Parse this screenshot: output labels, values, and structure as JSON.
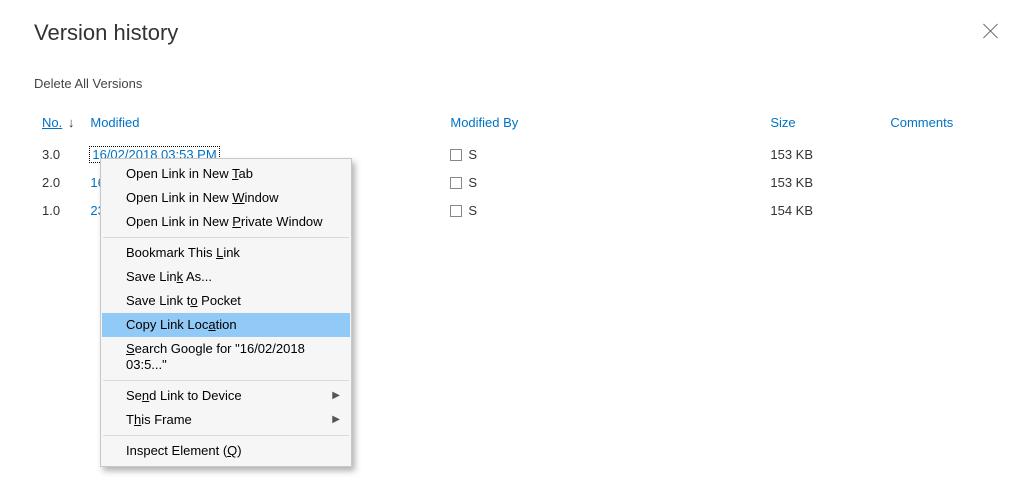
{
  "title": "Version history",
  "close_label": "Close",
  "delete_all_label": "Delete All Versions",
  "columns": {
    "no": "No.",
    "modified": "Modified",
    "modified_by": "Modified By",
    "size": "Size",
    "comments": "Comments"
  },
  "sort_arrow": "↓",
  "rows": [
    {
      "no": "3.0",
      "modified": "16/02/2018 03:53 PM",
      "modified_focused": true,
      "by": "S",
      "size": "153 KB",
      "comments": ""
    },
    {
      "no": "2.0",
      "modified": "16/",
      "modified_focused": false,
      "by": "S",
      "size": "153 KB",
      "comments": ""
    },
    {
      "no": "1.0",
      "modified": "23/",
      "modified_focused": false,
      "by": "S",
      "size": "154 KB",
      "comments": ""
    }
  ],
  "context_menu": {
    "open_tab": {
      "pre": "Open Link in New ",
      "u": "T",
      "post": "ab"
    },
    "open_window": {
      "pre": "Open Link in New ",
      "u": "W",
      "post": "indow"
    },
    "open_private": {
      "pre": "Open Link in New ",
      "u": "P",
      "post": "rivate Window"
    },
    "bookmark": {
      "pre": "Bookmark This ",
      "u": "L",
      "post": "ink"
    },
    "save_as": {
      "pre": "Save Lin",
      "u": "k",
      "post": " As..."
    },
    "save_pocket": {
      "pre": "Save Link t",
      "u": "o",
      "post": " Pocket"
    },
    "copy_location": {
      "pre": "Copy Link Loc",
      "u": "a",
      "post": "tion"
    },
    "search_google": {
      "pre": "",
      "u": "S",
      "post": "earch Google for \"16/02/2018 03:5...\""
    },
    "send_device": {
      "pre": "Se",
      "u": "n",
      "post": "d Link to Device"
    },
    "this_frame": {
      "pre": "T",
      "u": "h",
      "post": "is Frame"
    },
    "inspect": {
      "pre": "Inspect Element (",
      "u": "Q",
      "post": ")"
    },
    "submenu_glyph": "▶"
  }
}
